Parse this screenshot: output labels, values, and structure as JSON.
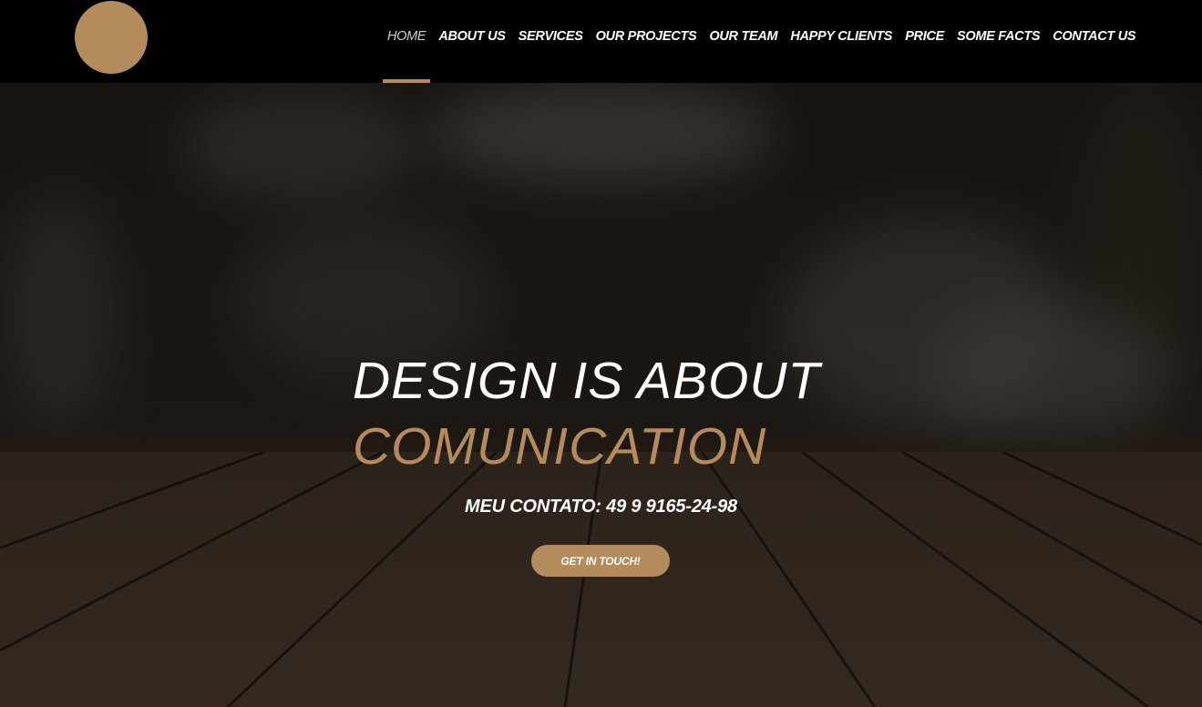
{
  "header": {
    "logo_icon": "circle-logo",
    "nav": [
      {
        "label": "HOME",
        "active": true
      },
      {
        "label": "ABOUT US"
      },
      {
        "label": "SERVICES"
      },
      {
        "label": "OUR PROJECTS"
      },
      {
        "label": "OUR TEAM"
      },
      {
        "label": "HAPPY CLIENTS"
      },
      {
        "label": "PRICE"
      },
      {
        "label": "SOME FACTS"
      },
      {
        "label": "CONTACT US"
      }
    ]
  },
  "hero": {
    "headline_line1": "DESIGN IS ABOUT",
    "headline_line2": "COMUNICATION",
    "contact_text": "MEU CONTATO: 49 9 9165-24-98",
    "cta_label": "GET IN TOUCH!"
  },
  "colors": {
    "accent": "#b38b5d",
    "header_bg": "#000000",
    "text": "#ffffff"
  }
}
